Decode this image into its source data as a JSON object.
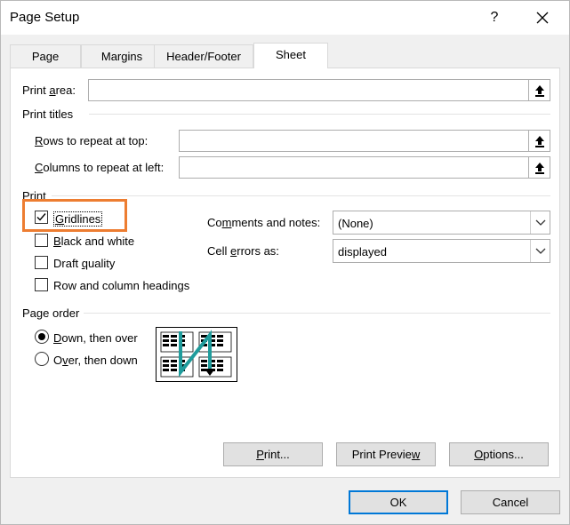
{
  "window": {
    "title": "Page Setup",
    "help_label": "?"
  },
  "tabs": [
    {
      "label": "Page"
    },
    {
      "label": "Margins"
    },
    {
      "label": "Header/Footer"
    },
    {
      "label": "Sheet",
      "active": true
    }
  ],
  "print_area": {
    "label_pre": "Print ",
    "label_key": "a",
    "label_post": "rea:",
    "value": ""
  },
  "print_titles": {
    "heading": "Print titles",
    "rows": {
      "label_key": "R",
      "label_post": "ows to repeat at top:",
      "value": ""
    },
    "columns": {
      "label_key": "C",
      "label_post": "olumns to repeat at left:",
      "value": ""
    }
  },
  "print": {
    "heading": "Print",
    "gridlines": {
      "label_key": "G",
      "label_post": "ridlines",
      "checked": true
    },
    "black_white": {
      "label_key": "B",
      "label_post": "lack and white",
      "checked": false
    },
    "draft": {
      "label_pre": "Draft ",
      "label_key": "q",
      "label_post": "uality",
      "checked": false
    },
    "row_col_headings": {
      "label": "Row and column headings",
      "checked": false
    },
    "comments": {
      "label_pre": "Co",
      "label_key": "m",
      "label_post": "ments and notes:",
      "value": "(None)"
    },
    "cell_errors": {
      "label_pre": "Cell ",
      "label_key": "e",
      "label_post": "rrors as:",
      "value": "displayed"
    }
  },
  "page_order": {
    "heading": "Page order",
    "down_then_over": {
      "label_key": "D",
      "label_post": "own, then over",
      "selected": true
    },
    "over_then_down": {
      "label_pre": "O",
      "label_key": "v",
      "label_post": "er, then down",
      "selected": false
    }
  },
  "buttons": {
    "print": {
      "label_key": "P",
      "label_post": "rint..."
    },
    "print_preview": {
      "label_pre": "Print Previe",
      "label_key": "w"
    },
    "options": {
      "label_key": "O",
      "label_post": "ptions..."
    },
    "ok": "OK",
    "cancel": "Cancel"
  },
  "colors": {
    "highlight": "#ed7d31",
    "default_button_border": "#0078d7",
    "arrow": "#1f9c9c"
  }
}
